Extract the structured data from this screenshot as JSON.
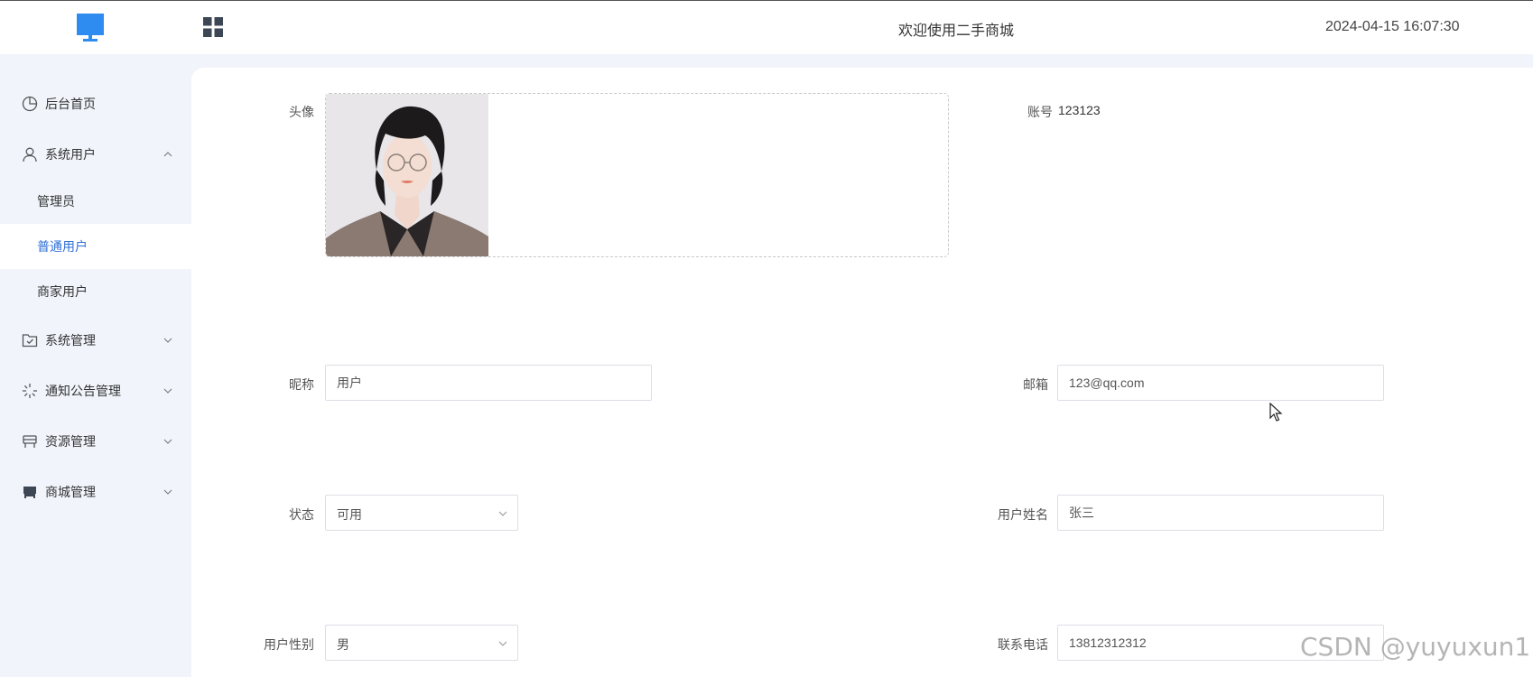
{
  "header": {
    "title": "欢迎使用二手商城",
    "datetime": "2024-04-15 16:07:30",
    "logo_icon": "monitor-icon",
    "menu_toggle_icon": "grid-icon",
    "brand_color": "#2e8cf0"
  },
  "sidebar": {
    "items": [
      {
        "label": "后台首页",
        "icon": "pie-chart-icon"
      },
      {
        "label": "系统用户",
        "icon": "user-icon",
        "expanded": true,
        "children": [
          {
            "label": "管理员"
          },
          {
            "label": "普通用户",
            "active": true
          },
          {
            "label": "商家用户"
          }
        ]
      },
      {
        "label": "系统管理",
        "icon": "folder-check-icon"
      },
      {
        "label": "通知公告管理",
        "icon": "loading-icon"
      },
      {
        "label": "资源管理",
        "icon": "desk-icon"
      },
      {
        "label": "商城管理",
        "icon": "shop-icon"
      }
    ],
    "active_color": "#2f6fd6"
  },
  "form": {
    "avatar_label": "头像",
    "account_label": "账号",
    "account_value": "123123",
    "nickname_label": "昵称",
    "nickname_value": "用户",
    "email_label": "邮箱",
    "email_value": "123@qq.com",
    "status_label": "状态",
    "status_value": "可用",
    "realname_label": "用户姓名",
    "realname_value": "张三",
    "gender_label": "用户性别",
    "gender_value": "男",
    "phone_label": "联系电话",
    "phone_value": "13812312312"
  },
  "watermark": "CSDN @yuyuxun1"
}
